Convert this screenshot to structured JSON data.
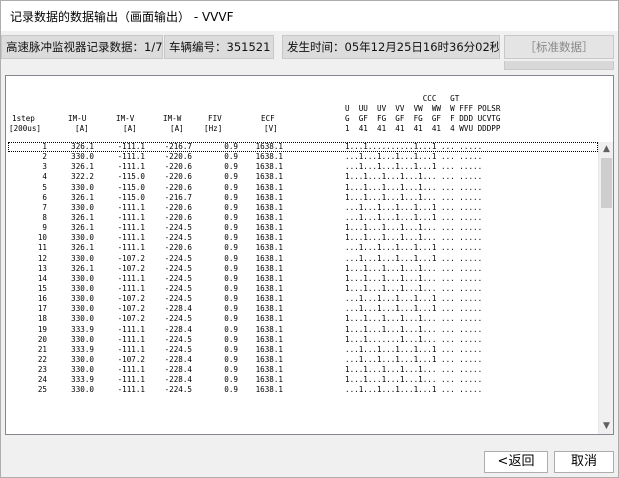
{
  "window": {
    "title": "记录数据的数据输出（画面输出） - VVVF"
  },
  "info": {
    "record": "高速脉冲监视器记录数据：1/7",
    "car_no": "车辆编号：351521",
    "time": "发生时间：05年12月25日16时36分02秒",
    "tag": "［标准数据］"
  },
  "header": {
    "col_step": [
      "1step",
      "[200us]"
    ],
    "col_imu": [
      "IM-U",
      "[A]"
    ],
    "col_imv": [
      "IM-V",
      "[A]"
    ],
    "col_imw": [
      "IM-W",
      "[A]"
    ],
    "col_fiv": [
      "FIV",
      "[Hz]"
    ],
    "col_ecf": [
      "ECF",
      "[V]"
    ],
    "flags_row1": "                 CCC   GT",
    "flags_row2": "U  UU  UV  VV  VW  WW  W FFF POLSR",
    "flags_row3": "G  GF  FG  GF  FG  GF  F DDD UCVTG",
    "flags_row4": "1  41  41  41  41  41  4 WVU DDDPP"
  },
  "rows": [
    {
      "step": "1",
      "imu": "326.1",
      "imv": "-111.1",
      "imw": "-216.7",
      "fiv": "0.9",
      "ecf": "1638.1",
      "flags": "1...1..........1...1 ... ....."
    },
    {
      "step": "2",
      "imu": "330.0",
      "imv": "-111.1",
      "imw": "-220.6",
      "fiv": "0.9",
      "ecf": "1638.1",
      "flags": "...1...1...1...1...1 ... ....."
    },
    {
      "step": "3",
      "imu": "326.1",
      "imv": "-111.1",
      "imw": "-220.6",
      "fiv": "0.9",
      "ecf": "1638.1",
      "flags": "...1...1...1...1...1 ... ....."
    },
    {
      "step": "4",
      "imu": "322.2",
      "imv": "-115.0",
      "imw": "-220.6",
      "fiv": "0.9",
      "ecf": "1638.1",
      "flags": "1...1...1...1...1... ... ....."
    },
    {
      "step": "5",
      "imu": "330.0",
      "imv": "-115.0",
      "imw": "-220.6",
      "fiv": "0.9",
      "ecf": "1638.1",
      "flags": "1...1...1...1...1... ... ....."
    },
    {
      "step": "6",
      "imu": "326.1",
      "imv": "-115.0",
      "imw": "-216.7",
      "fiv": "0.9",
      "ecf": "1638.1",
      "flags": "1...1...1...1...1... ... ....."
    },
    {
      "step": "7",
      "imu": "330.0",
      "imv": "-111.1",
      "imw": "-220.6",
      "fiv": "0.9",
      "ecf": "1638.1",
      "flags": "...1...1...1...1...1 ... ....."
    },
    {
      "step": "8",
      "imu": "326.1",
      "imv": "-111.1",
      "imw": "-220.6",
      "fiv": "0.9",
      "ecf": "1638.1",
      "flags": "...1...1...1...1...1 ... ....."
    },
    {
      "step": "9",
      "imu": "326.1",
      "imv": "-111.1",
      "imw": "-224.5",
      "fiv": "0.9",
      "ecf": "1638.1",
      "flags": "1...1...1...1...1... ... ....."
    },
    {
      "step": "10",
      "imu": "330.0",
      "imv": "-111.1",
      "imw": "-224.5",
      "fiv": "0.9",
      "ecf": "1638.1",
      "flags": "1...1...1...1...1... ... ....."
    },
    {
      "step": "11",
      "imu": "326.1",
      "imv": "-111.1",
      "imw": "-220.6",
      "fiv": "0.9",
      "ecf": "1638.1",
      "flags": "...1...1...1...1...1 ... ....."
    },
    {
      "step": "12",
      "imu": "330.0",
      "imv": "-107.2",
      "imw": "-224.5",
      "fiv": "0.9",
      "ecf": "1638.1",
      "flags": "...1...1...1...1...1 ... ....."
    },
    {
      "step": "13",
      "imu": "326.1",
      "imv": "-107.2",
      "imw": "-224.5",
      "fiv": "0.9",
      "ecf": "1638.1",
      "flags": "1...1...1...1...1... ... ....."
    },
    {
      "step": "14",
      "imu": "330.0",
      "imv": "-111.1",
      "imw": "-224.5",
      "fiv": "0.9",
      "ecf": "1638.1",
      "flags": "1...1...1...1...1... ... ....."
    },
    {
      "step": "15",
      "imu": "330.0",
      "imv": "-111.1",
      "imw": "-224.5",
      "fiv": "0.9",
      "ecf": "1638.1",
      "flags": "1...1...1...1...1... ... ....."
    },
    {
      "step": "16",
      "imu": "330.0",
      "imv": "-107.2",
      "imw": "-224.5",
      "fiv": "0.9",
      "ecf": "1638.1",
      "flags": "...1...1...1...1...1 ... ....."
    },
    {
      "step": "17",
      "imu": "330.0",
      "imv": "-107.2",
      "imw": "-228.4",
      "fiv": "0.9",
      "ecf": "1638.1",
      "flags": "...1...1...1...1...1 ... ....."
    },
    {
      "step": "18",
      "imu": "330.0",
      "imv": "-107.2",
      "imw": "-224.5",
      "fiv": "0.9",
      "ecf": "1638.1",
      "flags": "1...1...1...1...1... ... ....."
    },
    {
      "step": "19",
      "imu": "333.9",
      "imv": "-111.1",
      "imw": "-228.4",
      "fiv": "0.9",
      "ecf": "1638.1",
      "flags": "1...1...1...1...1... ... ....."
    },
    {
      "step": "20",
      "imu": "330.0",
      "imv": "-111.1",
      "imw": "-224.5",
      "fiv": "0.9",
      "ecf": "1638.1",
      "flags": "1...1.......1...1... ... ....."
    },
    {
      "step": "21",
      "imu": "333.9",
      "imv": "-111.1",
      "imw": "-224.5",
      "fiv": "0.9",
      "ecf": "1638.1",
      "flags": "...1...1...1...1...1 ... ....."
    },
    {
      "step": "22",
      "imu": "330.0",
      "imv": "-107.2",
      "imw": "-228.4",
      "fiv": "0.9",
      "ecf": "1638.1",
      "flags": "...1...1...1...1...1 ... ....."
    },
    {
      "step": "23",
      "imu": "330.0",
      "imv": "-111.1",
      "imw": "-228.4",
      "fiv": "0.9",
      "ecf": "1638.1",
      "flags": "1...1...1...1...1... ... ....."
    },
    {
      "step": "24",
      "imu": "333.9",
      "imv": "-111.1",
      "imw": "-228.4",
      "fiv": "0.9",
      "ecf": "1638.1",
      "flags": "1...1...1...1...1... ... ....."
    },
    {
      "step": "25",
      "imu": "330.0",
      "imv": "-111.1",
      "imw": "-224.5",
      "fiv": "0.9",
      "ecf": "1638.1",
      "flags": "...1...1...1...1...1 ... ....."
    }
  ],
  "scroll": {
    "up_icon": "chevron-up-icon",
    "down_icon": "chevron-down-icon"
  },
  "buttons": {
    "back": "<返回",
    "cancel": "取消"
  }
}
